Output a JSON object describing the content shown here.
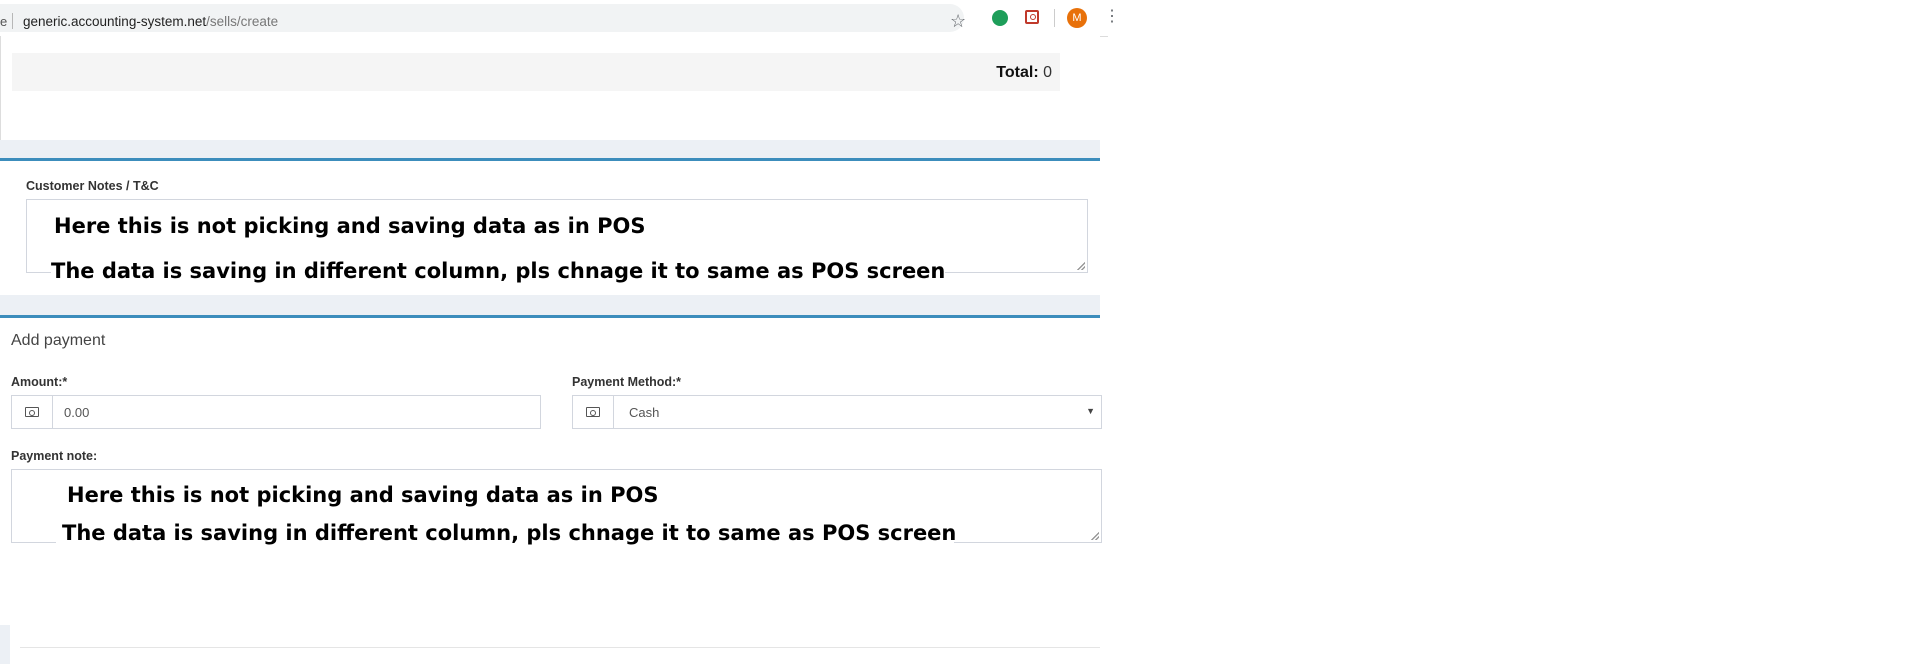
{
  "browser": {
    "address_prefix": "e",
    "url_host": "generic.accounting-system.net",
    "url_path": "/sells/create",
    "avatar_letter": "M",
    "icons": [
      "star-icon",
      "extension-green-icon",
      "extension-red-icon",
      "menu-icon"
    ]
  },
  "totals": {
    "total_label": "Total:",
    "total_value": "0"
  },
  "notes": {
    "label": "Customer Notes / T&C",
    "annotation_line1": "Here this is not picking and saving data as in POS",
    "annotation_line2": "The data is saving in different column, pls chnage it to same as POS screen"
  },
  "payment": {
    "title": "Add payment",
    "amount_label": "Amount:*",
    "amount_value": "0.00",
    "method_label": "Payment Method:*",
    "method_value": "Cash",
    "note_label": "Payment note:",
    "annotation_line1": "Here this is not picking and saving data as in POS",
    "annotation_line2": "The data is saving in different column, pls chnage it to same as POS screen"
  },
  "colors": {
    "box_border_accent": "#3c8dbc",
    "page_background": "#ecf0f5",
    "avatar_bg": "#e8710a"
  }
}
